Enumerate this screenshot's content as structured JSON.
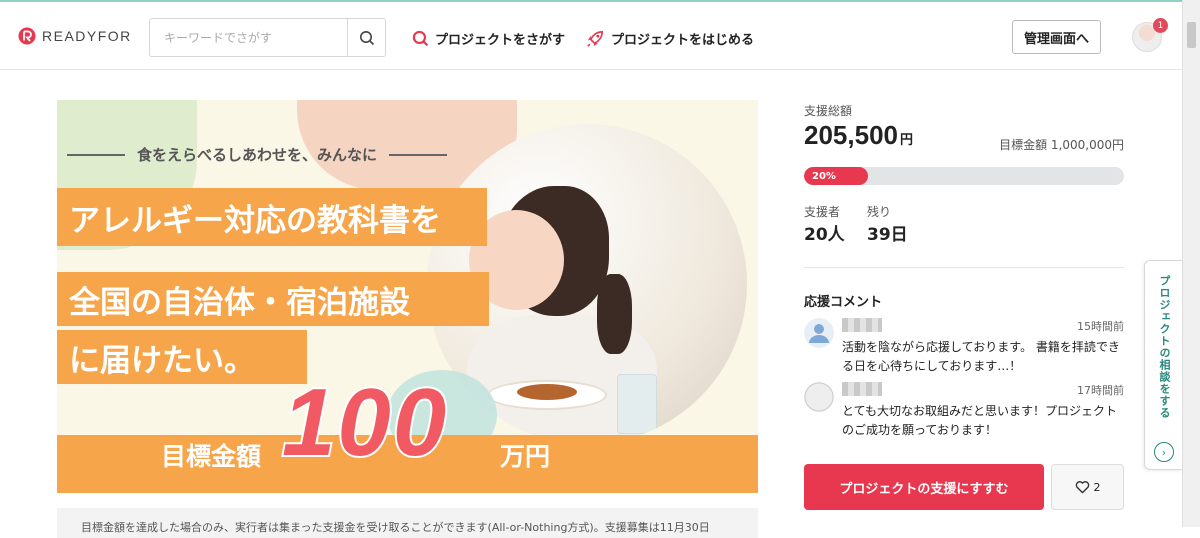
{
  "header": {
    "logo_text": "READYFOR",
    "search_placeholder": "キーワードでさがす",
    "nav_find": "プロジェクトをさがす",
    "nav_start": "プロジェクトをはじめる",
    "admin_button": "管理画面へ",
    "notification_count": "1"
  },
  "hero": {
    "tagline": "食をえらべるしあわせを、みんなに",
    "line1": "アレルギー対応の教科書を",
    "line2": "全国の自治体・宿泊施設",
    "line3": "に届けたい。",
    "goal_prefix": "目標金額",
    "goal_number": "100",
    "goal_suffix": "万円"
  },
  "notice": "目標金額を達成した場合のみ、実行者は集まった支援金を受け取ることができます(All-or-Nothing方式)。支援募集は11月30日",
  "funding": {
    "total_label": "支援総額",
    "total_amount": "205,500",
    "currency": "円",
    "target_label": "目標金額 1,000,000円",
    "progress_percent": 20,
    "progress_label": "20%",
    "supporters_label": "支援者",
    "supporters_value": "20人",
    "remaining_label": "残り",
    "remaining_value": "39日"
  },
  "comments": {
    "title": "応援コメント",
    "items": [
      {
        "time": "15時間前",
        "text": "活動を陰ながら応援しております。 書籍を拝読できる日を心待ちにしております…！"
      },
      {
        "time": "17時間前",
        "text": "とても大切なお取組みだと思います！プロジェクトのご成功を願っております！"
      }
    ]
  },
  "actions": {
    "support_button": "プロジェクトの支援にすすむ",
    "like_count": "2"
  },
  "side_tab": {
    "label": "プロジェクトの相談をする"
  },
  "colors": {
    "accent": "#e8384f",
    "hero_orange": "#f7a54a",
    "teal": "#2a8a7f"
  }
}
